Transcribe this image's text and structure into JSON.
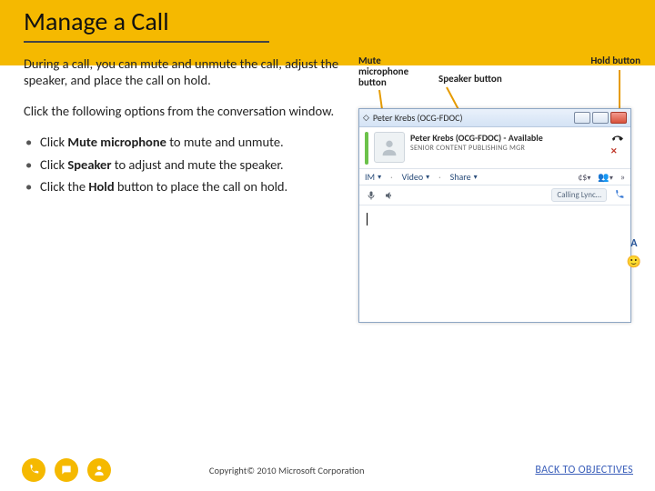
{
  "title": "Manage a Call",
  "intro": "During a call, you can mute and unmute the call, adjust the speaker, and place the call on hold.",
  "click_prompt": "Click the following options from the conversation window.",
  "bullets": [
    {
      "pre": "Click ",
      "strong": "Mute microphone",
      "post": " to mute and unmute."
    },
    {
      "pre": "Click ",
      "strong": "Speaker",
      "post": " to adjust and mute the speaker."
    },
    {
      "pre": "Click the ",
      "strong": "Hold",
      "post": " button to place the call on hold."
    }
  ],
  "labels": {
    "mute": "Mute microphone button",
    "speaker": "Speaker button",
    "hold": "Hold button"
  },
  "window": {
    "title": "Peter Krebs (OCG-FDOC)",
    "contact_name": "Peter Krebs (OCG-FDOC) - Available",
    "contact_role": "SENIOR CONTENT PUBLISHING MGR",
    "tabs": {
      "im": "IM",
      "video": "Video",
      "share": "Share"
    },
    "calling": "Calling Lync…"
  },
  "side": {
    "letter": "A"
  },
  "footer": {
    "copyright": "Copyright© 2010 Microsoft Corporation",
    "back": "BACK TO OBJECTIVES"
  }
}
